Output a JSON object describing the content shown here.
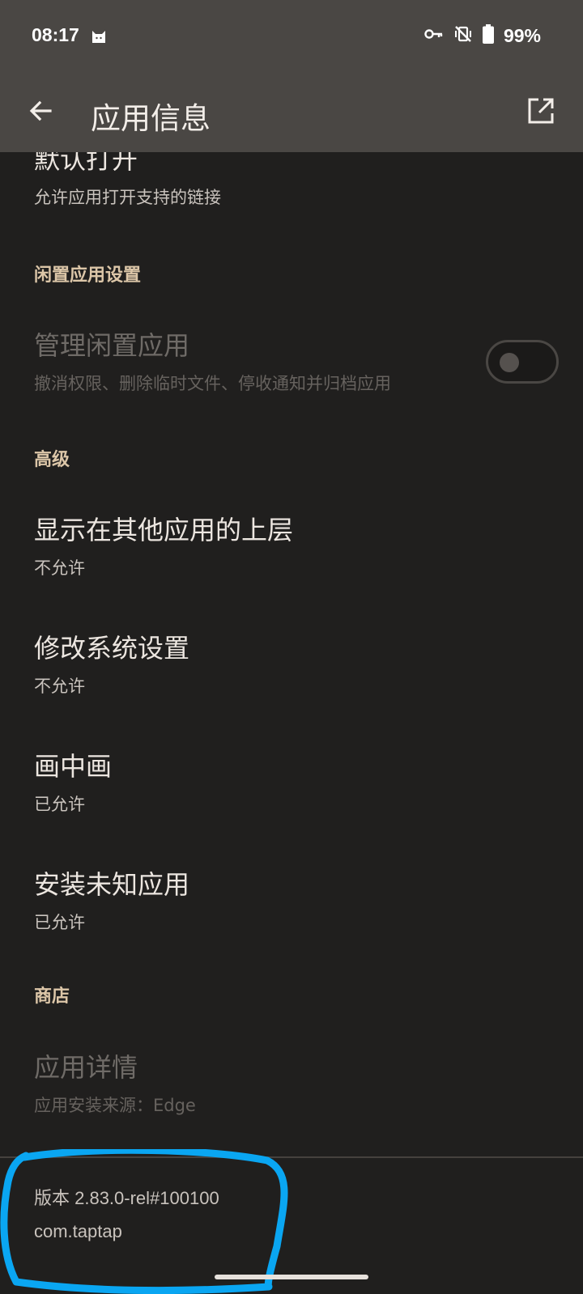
{
  "status_bar": {
    "time": "08:17",
    "battery": "99%"
  },
  "app_bar": {
    "title": "应用信息"
  },
  "items": {
    "default_open": {
      "title": "默认打开",
      "subtitle": "允许应用打开支持的链接"
    },
    "section_idle": "闲置应用设置",
    "manage_idle": {
      "title": "管理闲置应用",
      "subtitle": "撤消权限、删除临时文件、停收通知并归档应用",
      "toggle_on": false
    },
    "section_advanced": "高级",
    "overlay": {
      "title": "显示在其他应用的上层",
      "subtitle": "不允许"
    },
    "modify_settings": {
      "title": "修改系统设置",
      "subtitle": "不允许"
    },
    "pip": {
      "title": "画中画",
      "subtitle": "已允许"
    },
    "install_unknown": {
      "title": "安装未知应用",
      "subtitle": "已允许"
    },
    "section_store": "商店",
    "app_details": {
      "title": "应用详情",
      "subtitle": "应用安装来源：Edge"
    }
  },
  "footer": {
    "version": "版本 2.83.0-rel#100100",
    "package": "com.taptap"
  },
  "colors": {
    "accent_section": "#dcc6a8",
    "annotation": "#0aa6f2",
    "background": "#201f1e",
    "toolbar": "#4a4744"
  }
}
